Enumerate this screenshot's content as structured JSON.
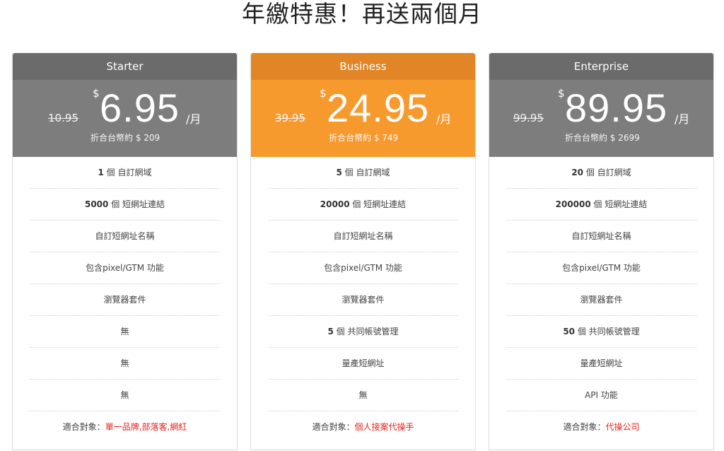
{
  "headline": "年繳特惠！再送兩個月",
  "plans": [
    {
      "name": "Starter",
      "old_price": "10.95",
      "currency": "$",
      "price": "6.95",
      "period": "/月",
      "twd_note": "折合台幣約 $ 209",
      "features": [
        {
          "num": "1",
          "text": " 個 自訂網域"
        },
        {
          "num": "5000",
          "text": " 個 短網址連結"
        },
        {
          "num": "",
          "text": "自訂短網址名稱"
        },
        {
          "num": "",
          "text": "包含pixel/GTM 功能"
        },
        {
          "num": "",
          "text": "瀏覽器套件"
        },
        {
          "num": "",
          "text": "無"
        },
        {
          "num": "",
          "text": "無"
        },
        {
          "num": "",
          "text": "無"
        }
      ],
      "target_label": "適合對象：",
      "target_value": "單一品牌,部落客,網紅"
    },
    {
      "name": "Business",
      "old_price": "39.95",
      "currency": "$",
      "price": "24.95",
      "period": "/月",
      "twd_note": "折合台幣約 $ 749",
      "features": [
        {
          "num": "5",
          "text": " 個 自訂網域"
        },
        {
          "num": "20000",
          "text": " 個 短網址連結"
        },
        {
          "num": "",
          "text": "自訂短網址名稱"
        },
        {
          "num": "",
          "text": "包含pixel/GTM 功能"
        },
        {
          "num": "",
          "text": "瀏覽器套件"
        },
        {
          "num": "5",
          "text": " 個 共同帳號管理"
        },
        {
          "num": "",
          "text": "量產短網址"
        },
        {
          "num": "",
          "text": "無"
        }
      ],
      "target_label": "適合對象：",
      "target_value": "個人接案代操手"
    },
    {
      "name": "Enterprise",
      "old_price": "99.95",
      "currency": "$",
      "price": "89.95",
      "period": "/月",
      "twd_note": "折合台幣約 $ 2699",
      "features": [
        {
          "num": "20",
          "text": " 個 自訂網域"
        },
        {
          "num": "200000",
          "text": " 個 短網址連結"
        },
        {
          "num": "",
          "text": "自訂短網址名稱"
        },
        {
          "num": "",
          "text": "包含pixel/GTM 功能"
        },
        {
          "num": "",
          "text": "瀏覽器套件"
        },
        {
          "num": "50",
          "text": " 個 共同帳號管理"
        },
        {
          "num": "",
          "text": "量產短網址"
        },
        {
          "num": "",
          "text": "API 功能"
        }
      ],
      "target_label": "適合對象：",
      "target_value": "代操公司"
    }
  ],
  "colors": {
    "header_gray": "#6b6b6b",
    "price_gray": "#7d7d7d",
    "header_orange": "#e18526",
    "price_orange": "#f79a2e",
    "highlight_red": "#e8231d"
  }
}
